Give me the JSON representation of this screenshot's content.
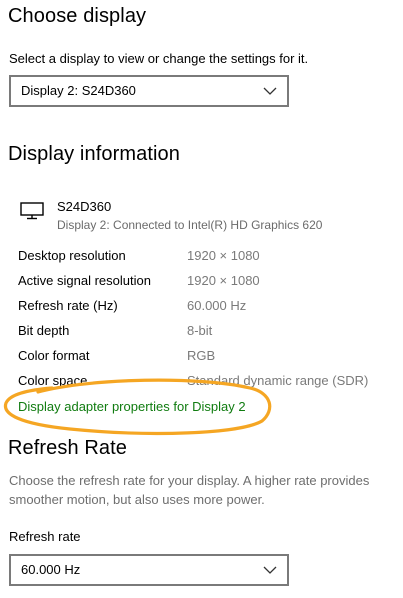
{
  "choose_display": {
    "title": "Choose display",
    "description": "Select a display to view or change the settings for it.",
    "selected": "Display 2: S24D360"
  },
  "display_information": {
    "title": "Display information",
    "monitor_name": "S24D360",
    "connection": "Display 2: Connected to Intel(R) HD Graphics 620",
    "rows": [
      {
        "label": "Desktop resolution",
        "value": "1920 × 1080"
      },
      {
        "label": "Active signal resolution",
        "value": "1920 × 1080"
      },
      {
        "label": "Refresh rate (Hz)",
        "value": "60.000 Hz"
      },
      {
        "label": "Bit depth",
        "value": "8-bit"
      },
      {
        "label": "Color format",
        "value": "RGB"
      },
      {
        "label": "Color space",
        "value": "Standard dynamic range (SDR)"
      }
    ],
    "adapter_link": "Display adapter properties for Display 2"
  },
  "refresh_rate": {
    "title": "Refresh Rate",
    "description": "Choose the refresh rate for your display. A higher rate provides smoother motion, but also uses more power.",
    "field_label": "Refresh rate",
    "selected": "60.000 Hz"
  },
  "colors": {
    "link": "#107c10",
    "annotation": "#f5a623",
    "muted_text": "#7a7a7a"
  },
  "icons": {
    "monitor": "monitor-icon",
    "chevron": "chevron-down-icon"
  }
}
